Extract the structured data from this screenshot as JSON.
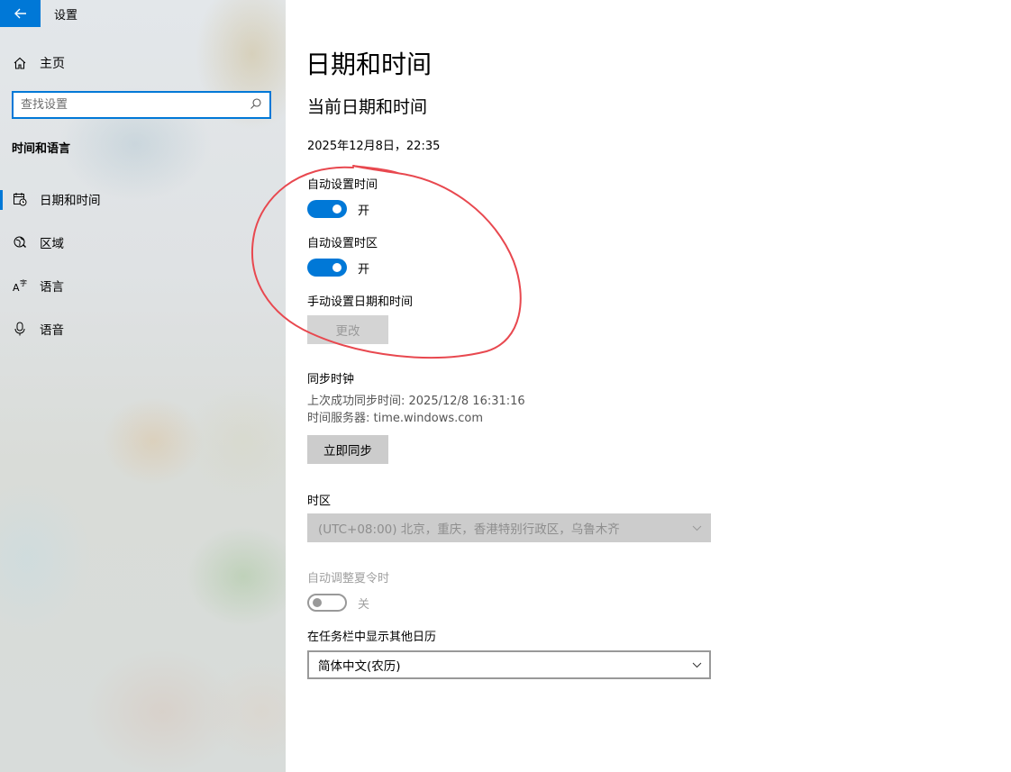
{
  "window": {
    "title": "设置"
  },
  "sidebar": {
    "home_label": "主页",
    "search_placeholder": "查找设置",
    "section_title": "时间和语言",
    "items": [
      {
        "label": "日期和时间",
        "icon": "calendar-clock-icon",
        "active": true
      },
      {
        "label": "区域",
        "icon": "globe-region-icon",
        "active": false
      },
      {
        "label": "语言",
        "icon": "language-icon",
        "active": false
      },
      {
        "label": "语音",
        "icon": "microphone-icon",
        "active": false
      }
    ]
  },
  "main": {
    "page_title": "日期和时间",
    "current_section_title": "当前日期和时间",
    "current_datetime": "2025年12月8日，22:35",
    "auto_time": {
      "label": "自动设置时间",
      "state_text": "开",
      "on": true
    },
    "auto_timezone": {
      "label": "自动设置时区",
      "state_text": "开",
      "on": true
    },
    "manual": {
      "label": "手动设置日期和时间",
      "button_label": "更改"
    },
    "sync": {
      "title": "同步时钟",
      "last_sync": "上次成功同步时间: 2025/12/8 16:31:16",
      "server": "时间服务器: time.windows.com",
      "button_label": "立即同步"
    },
    "timezone": {
      "label": "时区",
      "value": "(UTC+08:00) 北京，重庆，香港特别行政区，乌鲁木齐"
    },
    "dst": {
      "label": "自动调整夏令时",
      "state_text": "关",
      "on": false
    },
    "calendar": {
      "label": "在任务栏中显示其他日历",
      "value": "简体中文(农历)"
    }
  },
  "colors": {
    "accent": "#0078d7",
    "annotation": "#e8484f"
  }
}
